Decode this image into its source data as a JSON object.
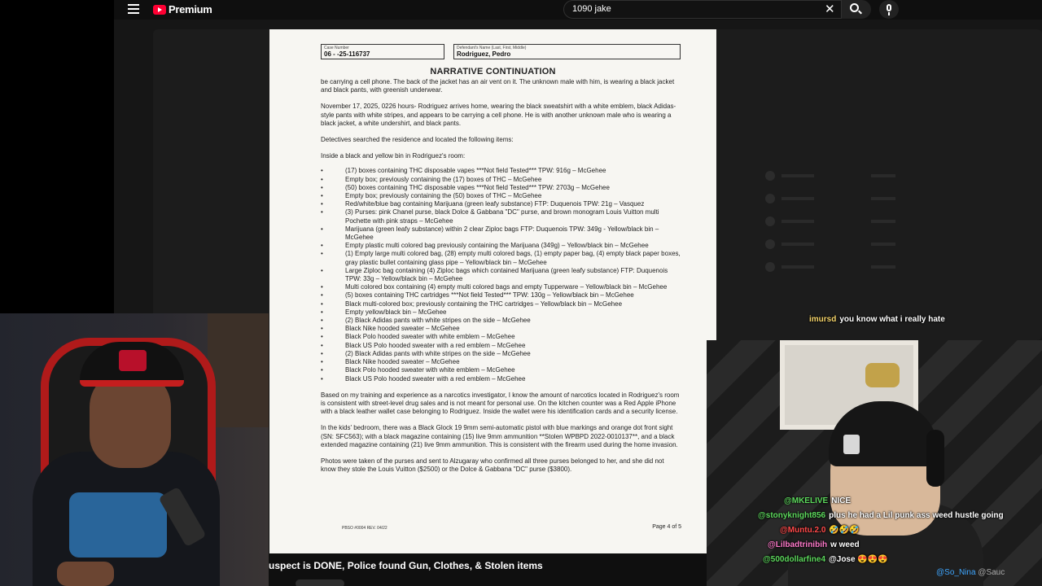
{
  "app": {
    "brand": "Premium",
    "search_value": "1090 jake"
  },
  "colors": {
    "yt_red": "#ff0033",
    "chat_yellow": "#f5d46b",
    "chat_green": "#5dd95d",
    "chat_red": "#ff4a4a",
    "chat_pink": "#ff7acb",
    "link_blue": "#3ea6ff"
  },
  "icons": [
    "menu-icon",
    "youtube-logo-icon",
    "close-icon",
    "search-icon",
    "mic-icon"
  ],
  "document": {
    "case_number_label": "Case Number",
    "case_number": "06 - -25-116737",
    "defendant_label": "Defendant's Name (Last, First, Middle)",
    "defendant_name": "Rodriguez, Pedro",
    "title": "NARRATIVE CONTINUATION",
    "para1": "be carrying a cell phone. The back of the jacket has an air vent on it. The unknown male with him, is wearing a black jacket and black pants, with greenish underwear.",
    "para2": "November 17, 2025, 0226 hours- Rodriguez arrives home, wearing the black sweatshirt with a white emblem, black Adidas-style pants with white stripes, and appears to be carrying a cell phone. He is with another unknown male who is wearing a black jacket, a white undershirt, and black pants.",
    "para3": "Detectives searched the residence and located the following items:",
    "para4": "Inside a black and yellow bin in Rodriguez's room:",
    "items": [
      "(17) boxes containing THC disposable vapes ***Not field Tested*** TPW: 916g – McGehee",
      "Empty box; previously containing the (17) boxes of THC – McGehee",
      "(50) boxes containing THC disposable vapes ***Not field Tested*** TPW: 2703g – McGehee",
      "Empty box; previously containing the (50) boxes of THC – McGehee",
      "Red/white/blue bag containing Marijuana (green leafy substance) FTP: Duquenois TPW: 21g – Vasquez",
      "(3) Purses: pink Chanel purse, black Dolce & Gabbana \"DC\" purse, and brown monogram Louis Vuitton multi Pochette with pink straps – McGehee",
      "Marijuana (green leafy substance) within 2 clear Ziploc bags FTP: Duquenois TPW: 349g - Yellow/black bin – McGehee",
      "Empty plastic multi colored bag previously containing the Marijuana (349g) – Yellow/black bin – McGehee",
      "(1) Empty large multi colored bag, (28) empty multi colored bags, (1) empty paper bag, (4) empty black paper boxes, gray plastic bullet containing glass pipe – Yellow/black bin – McGehee",
      "Large Ziploc bag containing (4) Ziploc bags which contained Marijuana (green leafy substance) FTP: Duquenois TPW: 33g – Yellow/black bin – McGehee",
      "Multi colored box containing (4) empty multi colored bags and empty Tupperware – Yellow/black bin – McGehee",
      "(5) boxes containing THC cartridges ***Not field Tested*** TPW: 130g – Yellow/black bin – McGehee",
      "Black multi-colored box; previously containing the THC cartridges – Yellow/black bin – McGehee",
      "Empty yellow/black bin – McGehee",
      "(2) Black Adidas pants with white stripes on the side – McGehee",
      "Black Nike hooded sweater – McGehee",
      "Black Polo hooded sweater with white emblem – McGehee",
      "Black US Polo hooded sweater with a red emblem – McGehee",
      "(2) Black Adidas pants with white stripes on the side – McGehee",
      "Black Nike hooded sweater – McGehee",
      "Black Polo hooded sweater with white emblem – McGehee",
      "Black US Polo hooded sweater with a red emblem – McGehee"
    ],
    "para5": "Based on my training and experience as a narcotics investigator, I know the amount of narcotics located in Rodriguez's room is consistent with street-level drug sales and is not meant for personal use. On the kitchen counter was a Red Apple iPhone with a black leather wallet case belonging to Rodriguez. Inside the wallet were his identification cards and a security license.",
    "para6": "In the kids' bedroom, there was a Black Glock 19 9mm semi-automatic pistol with blue markings and orange dot front sight (SN: SFC563); with a black magazine containing (15) live 9mm ammunition **Stolen WPBPD 2022-0010137**, and a black extended magazine containing (21) live 9mm ammunition. This is consistent with the firearm used during the home invasion.",
    "para7": "Photos were taken of the purses and sent to Alzugaray who confirmed all three purses belonged to her, and she did not know they stole the Louis Vuitton ($2500) or the Dolce & Gabbana \"DC\" purse ($3800).",
    "footer_form": "PBSO #0004 REV. 04/22",
    "page": "Page 4 of 5"
  },
  "video": {
    "title": "uspect is DONE, Police found Gun, Clothes, & Stolen items"
  },
  "chat": [
    {
      "user": "imursd",
      "message": "you know what i really hate"
    },
    {
      "user": "@MKELIVE",
      "message": "NICE"
    },
    {
      "user": "@stonyknight856",
      "message": "plus he had a Lil punk ass weed hustle going"
    },
    {
      "user": "@Muntu.2.0",
      "message": "🤣🤣🤣"
    },
    {
      "user": "@Lilbadtrinibih",
      "message": "w weed"
    },
    {
      "user": "@500dollarfine4",
      "message": "@Jose 😍😍😍"
    }
  ],
  "bottom_names": {
    "n1": "@So_Nina",
    "n2": "@Sauc"
  }
}
